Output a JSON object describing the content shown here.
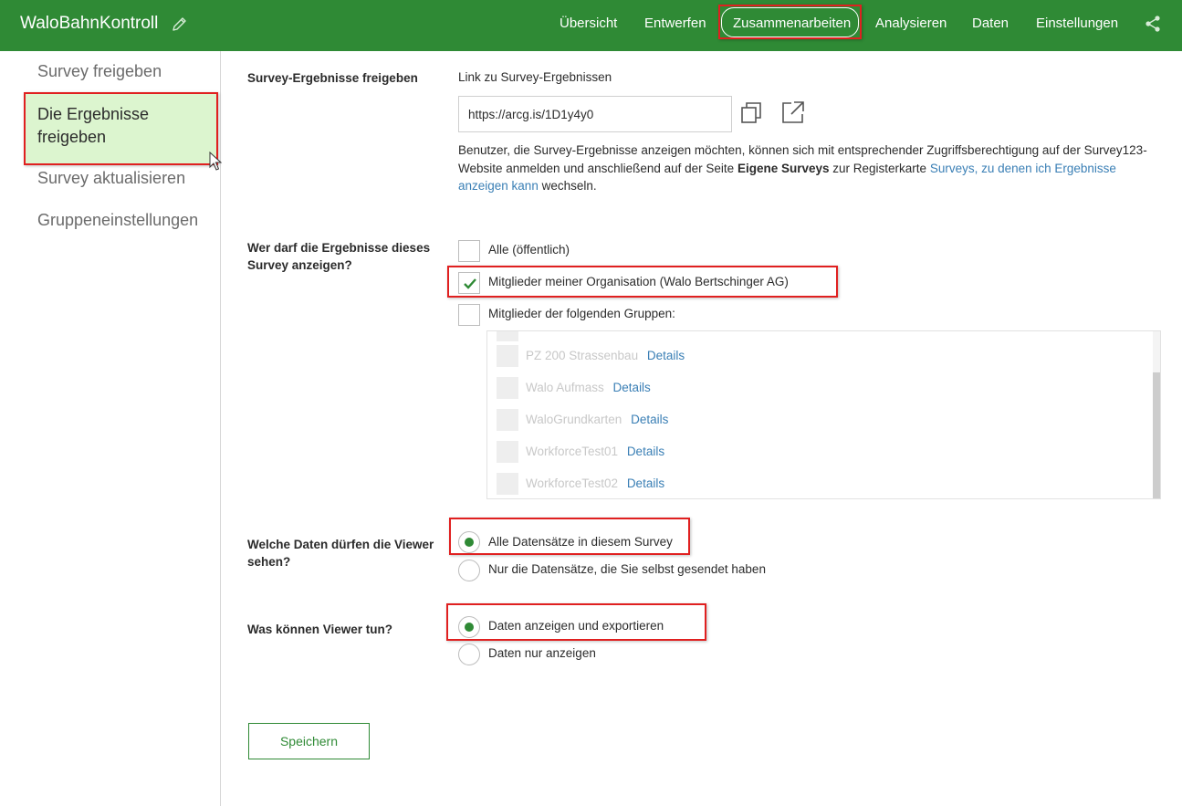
{
  "header": {
    "title": "WaloBahnKontroll",
    "nav": [
      "Übersicht",
      "Entwerfen",
      "Zusammenarbeiten",
      "Analysieren",
      "Daten",
      "Einstellungen"
    ],
    "active_nav": "Zusammenarbeiten",
    "icons": {
      "edit": "pencil-icon",
      "share": "share-icon"
    },
    "accent_color": "#2f8a35"
  },
  "sidebar": {
    "items": [
      {
        "label": "Survey freigeben"
      },
      {
        "label": "Die Ergebnisse freigeben",
        "line1": "Die Ergebnisse",
        "line2": "freigeben",
        "active": true
      },
      {
        "label": "Survey aktualisieren"
      },
      {
        "label": "Gruppeneinstellungen"
      }
    ],
    "active_bg": "#dcf5cf"
  },
  "share_results": {
    "label": "Survey-Ergebnisse freigeben",
    "link_label": "Link zu Survey-Ergebnissen",
    "link_value": "https://arcg.is/1D1y4y0",
    "icons": {
      "copy": "copy-icon",
      "open": "open-external-icon"
    },
    "desc_part1": "Benutzer, die Survey-Ergebnisse anzeigen möchten, können sich mit entsprechender Zugriffsberechtigung auf der Survey123-Website anmelden und anschließend auf der Seite ",
    "desc_bold": "Eigene Surveys",
    "desc_part2": " zur Registerkarte ",
    "desc_link": "Surveys, zu denen ich Ergebnisse anzeigen kann",
    "desc_part3": " wechseln."
  },
  "who_can_view": {
    "label_line1": "Wer darf die Ergebnisse dieses",
    "label_line2": "Survey anzeigen?",
    "options": [
      {
        "label": "Alle (öffentlich)",
        "checked": false
      },
      {
        "label": "Mitglieder meiner Organisation (Walo Bertschinger AG)",
        "checked": true
      },
      {
        "label": "Mitglieder der folgenden Gruppen:",
        "checked": false
      }
    ],
    "groups": [
      {
        "name": "PZ 200 Strassenbau",
        "link": "Details"
      },
      {
        "name": "Walo Aufmass",
        "link": "Details"
      },
      {
        "name": "WaloGrundkarten",
        "link": "Details"
      },
      {
        "name": "WorkforceTest01",
        "link": "Details"
      },
      {
        "name": "WorkforceTest02",
        "link": "Details"
      }
    ]
  },
  "data_scope": {
    "label_line1": "Welche Daten dürfen die Viewer",
    "label_line2": "sehen?",
    "options": [
      {
        "label": "Alle Datensätze in diesem Survey",
        "selected": true
      },
      {
        "label": "Nur die Datensätze, die Sie selbst gesendet haben",
        "selected": false
      }
    ]
  },
  "viewer_actions": {
    "label": "Was können Viewer tun?",
    "options": [
      {
        "label": "Daten anzeigen und exportieren",
        "selected": true
      },
      {
        "label": "Daten nur anzeigen",
        "selected": false
      }
    ]
  },
  "save_label": "Speichern"
}
